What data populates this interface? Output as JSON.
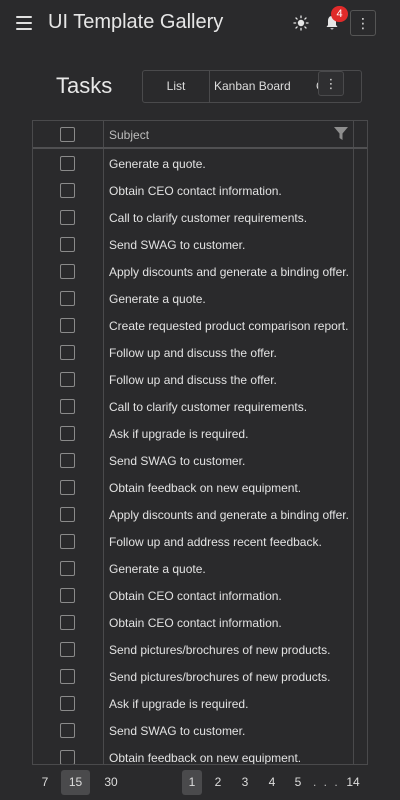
{
  "app": {
    "title": "UI Template Gallery",
    "notification_count": "4",
    "menu_icon": "hamburger-menu-icon",
    "theme_icon": "sun-icon",
    "notifications_icon": "bell-icon",
    "more_icon": "more-vertical-icon"
  },
  "page": {
    "title": "Tasks",
    "tabs": [
      "List",
      "Kanban Board",
      "G"
    ],
    "more_icon": "more-vertical-icon"
  },
  "grid": {
    "columns": {
      "subject": "Subject"
    },
    "rows": [
      "Generate a quote.",
      "Obtain CEO contact information.",
      "Call to clarify customer requirements.",
      "Send SWAG to customer.",
      "Apply discounts and generate a binding offer.",
      "Generate a quote.",
      "Create requested product comparison report.",
      "Follow up and discuss the offer.",
      "Follow up and discuss the offer.",
      "Call to clarify customer requirements.",
      "Ask if upgrade is required.",
      "Send SWAG to customer.",
      "Obtain feedback on new equipment.",
      "Apply discounts and generate a binding offer.",
      "Follow up and address recent feedback.",
      "Generate a quote.",
      "Obtain CEO contact information.",
      "Obtain CEO contact information.",
      "Send pictures/brochures of new products.",
      "Send pictures/brochures of new products.",
      "Ask if upgrade is required.",
      "Send SWAG to customer.",
      "Obtain feedback on new equipment."
    ]
  },
  "pager": {
    "page_sizes": [
      "7",
      "15",
      "30"
    ],
    "selected_page_size": "15",
    "pages": [
      "1",
      "2",
      "3",
      "4",
      "5"
    ],
    "ellipsis": ". . .",
    "last_page": "14",
    "current_page": "1"
  },
  "colors": {
    "background": "#2a2a2c",
    "badge": "#e02a2a",
    "border": "#4a4a4c"
  }
}
